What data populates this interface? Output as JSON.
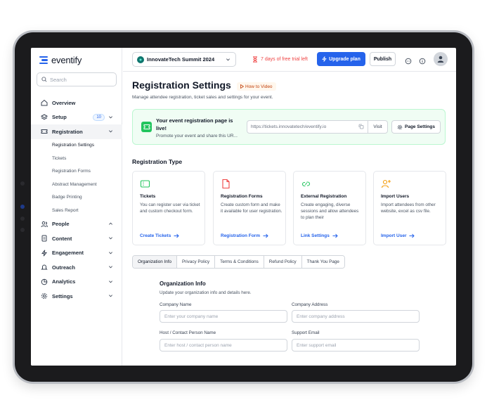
{
  "app": {
    "name": "eventify"
  },
  "sidebar": {
    "search_placeholder": "Search",
    "items": [
      {
        "label": "Overview"
      },
      {
        "label": "Setup",
        "badge": "10"
      },
      {
        "label": "Registration"
      },
      {
        "label": "People"
      },
      {
        "label": "Content"
      },
      {
        "label": "Engagement"
      },
      {
        "label": "Outreach"
      },
      {
        "label": "Analytics"
      },
      {
        "label": "Settings"
      }
    ],
    "registration_subitems": [
      "Registration Settings",
      "Tickets",
      "Registration Forms",
      "Abstract Management",
      "Badge Printing",
      "Sales Report"
    ]
  },
  "topbar": {
    "event_name": "InnovateTech Summit 2024",
    "trial_text": "7 days of free trial left",
    "upgrade_label": "Upgrade plan",
    "publish_label": "Publish"
  },
  "page": {
    "title": "Registration Settings",
    "how_to_label": "How to Video",
    "subtitle": "Manage attendee registration, ticket sales and settings for your event."
  },
  "banner": {
    "title": "Your event registration page is live!",
    "description": "Promote your event and share this UR...",
    "url": "https://tickets.innovatetech/eventify.io",
    "visit_label": "Visit",
    "page_settings_label": "Page Settings"
  },
  "registration_type": {
    "title": "Registration Type",
    "cards": [
      {
        "title": "Tickets",
        "description": "You can register user via ticket and custom checkout form.",
        "link": "Create Tickets"
      },
      {
        "title": "Registration Forms",
        "description": "Create custom form and make it available for user registration.",
        "link": "Registration Form"
      },
      {
        "title": "External Registration",
        "description": "Create engaging, diverse sessions and allow attendees to plan their",
        "link": "Link Settings"
      },
      {
        "title": "Import Users",
        "description": "Import attendees from other website, excel as csv file.",
        "link": "Import User"
      }
    ]
  },
  "tabs": [
    {
      "label": "Organization Info"
    },
    {
      "label": "Privacy Policy"
    },
    {
      "label": "Terms & Conditions"
    },
    {
      "label": "Refund Policy"
    },
    {
      "label": "Thank You Page"
    }
  ],
  "form": {
    "title": "Organization Info",
    "subtitle": "Update your organization info and details here.",
    "company_name_label": "Company Name",
    "company_name_placeholder": "Enter your company name",
    "company_address_label": "Company Address",
    "company_address_placeholder": "Enter company address",
    "host_label": "Host / Contact Person Name",
    "host_placeholder": "Enter host / contact person name",
    "support_email_label": "Support Email",
    "support_email_placeholder": "Enter support email"
  },
  "colors": {
    "accent": "#2563eb",
    "success": "#22c55e",
    "warning": "#ef4444"
  }
}
